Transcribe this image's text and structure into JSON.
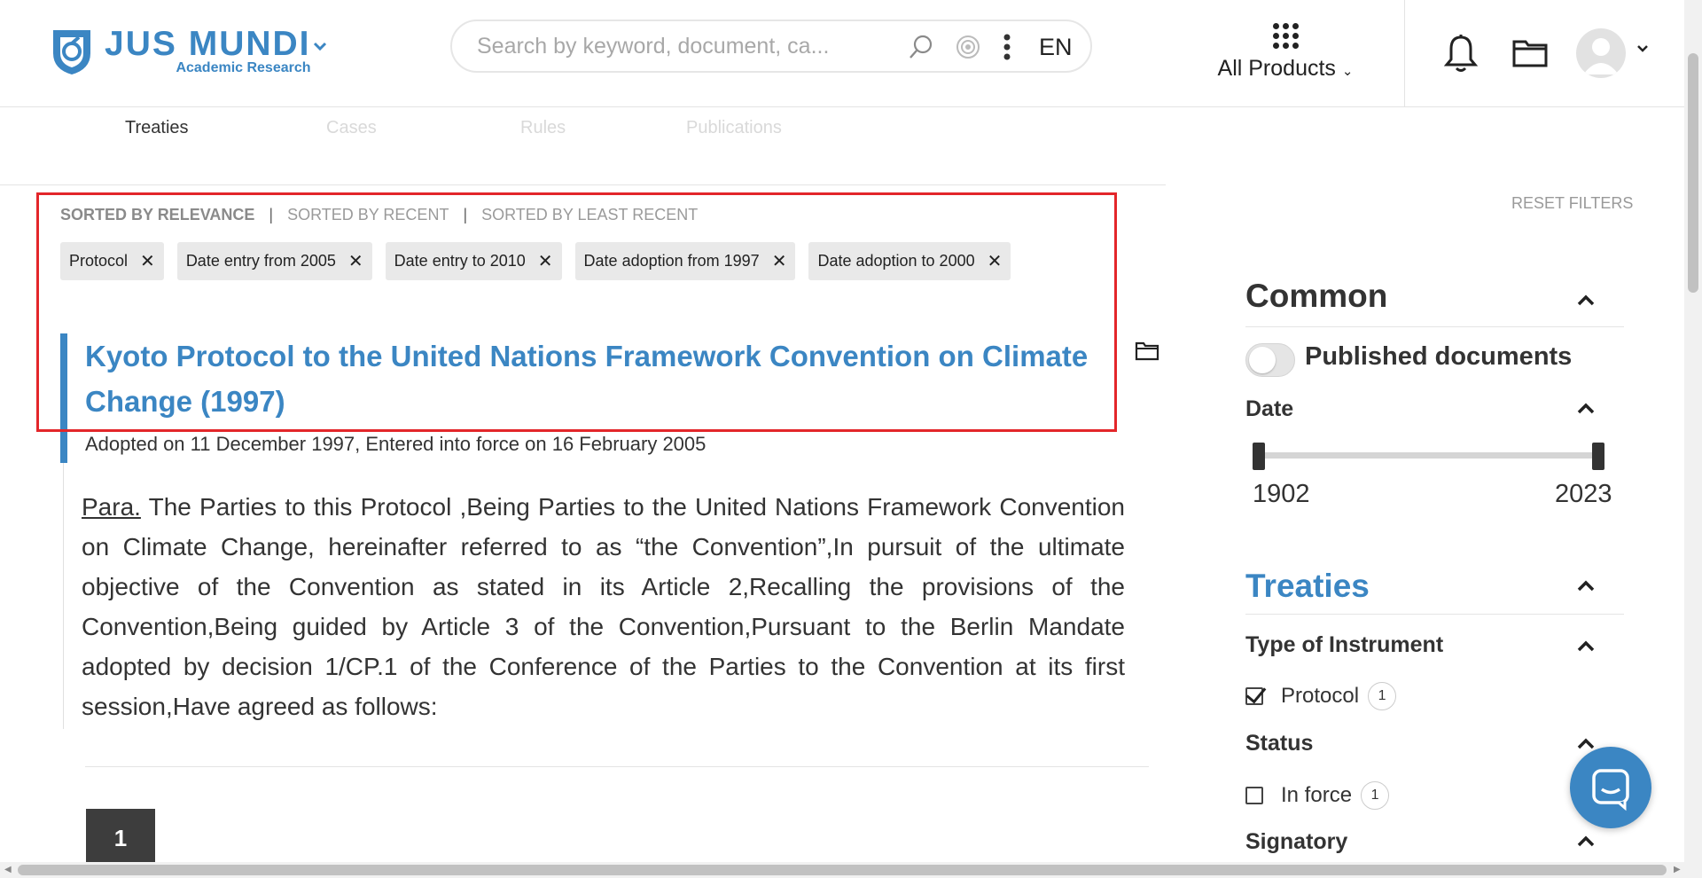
{
  "header": {
    "logo": {
      "name": "JUS MUNDI",
      "subtitle": "Academic Research",
      "brand_color": "#3b86c3"
    },
    "search": {
      "placeholder": "Search by keyword, document, ca...",
      "language": "EN"
    },
    "products_label": "All Products"
  },
  "tabs": [
    {
      "label": "Treaties",
      "active": true
    },
    {
      "label": "Cases",
      "active": false
    },
    {
      "label": "Rules",
      "active": false
    },
    {
      "label": "Publications",
      "active": false
    }
  ],
  "sort": {
    "options": [
      "SORTED BY RELEVANCE",
      "SORTED BY RECENT",
      "SORTED BY LEAST RECENT"
    ],
    "active": "SORTED BY RELEVANCE"
  },
  "filters": [
    "Protocol",
    "Date entry from 2005",
    "Date entry to 2010",
    "Date adoption from 1997",
    "Date adoption to 2000"
  ],
  "result": {
    "title": "Kyoto Protocol to the United Nations Framework Convention on Climate Change (1997)",
    "meta": "Adopted on 11 December 1997, Entered into force on 16 February 2005",
    "para_label": "Para.",
    "para_text": " The Parties to this Protocol ,Being Parties to the United Nations Framework Convention on Climate Change, hereinafter referred to as “the Convention”,In pursuit of the ultimate objective of the Convention as stated in its Article 2,Recalling the provisions of the Convention,Being guided by Article 3 of the Convention,Pursuant to the Berlin Mandate adopted by decision 1/CP.1 of the Conference of the Parties to the Convention at its first session,Have agreed as follows:"
  },
  "pagination": {
    "current": "1"
  },
  "sidebar": {
    "reset_label": "RESET FILTERS",
    "common_heading": "Common",
    "published_label": "Published documents",
    "published_on": false,
    "date_heading": "Date",
    "date_min": "1902",
    "date_max": "2023",
    "treaties_heading": "Treaties",
    "instrument_heading": "Type of Instrument",
    "instrument_option": {
      "label": "Protocol",
      "count": "1",
      "checked": true
    },
    "status_heading": "Status",
    "status_option": {
      "label": "In force",
      "count": "1",
      "checked": false
    },
    "signatory_heading": "Signatory"
  },
  "colors": {
    "accent": "#3b86c3",
    "highlight_border": "#e3262a"
  }
}
